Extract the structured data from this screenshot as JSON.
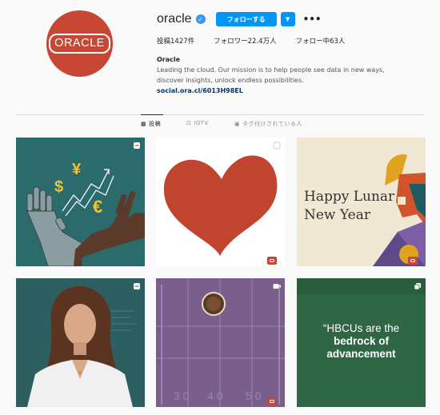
{
  "profile": {
    "avatar_text": "ORACLE",
    "username": "oracle",
    "follow_label": "フォローする",
    "dropdown_icon": "chevron-down-icon",
    "more_icon": "more-icon",
    "stats": {
      "posts": "投稿1427件",
      "followers": "フォロワー22.4万人",
      "following": "フォロー中63人"
    },
    "bio": {
      "name": "Oracle",
      "text": "Leading the cloud. Our mission is to help people see data in new ways, discover insights, unlock endless possibilities.",
      "link": "social.ora.cl/6013H98EL"
    }
  },
  "tabs": [
    {
      "label": "投稿",
      "icon": "grid-icon"
    },
    {
      "label": "IGTV",
      "icon": "igtv-icon"
    },
    {
      "label": "タグ付けされている人",
      "icon": "tag-icon"
    }
  ],
  "posts": {
    "lunar_text_1": "Happy Lunar",
    "lunar_text_2": "New Year",
    "hbcu_line1": "“HBCUs are the",
    "hbcu_line2": "bedrock of",
    "hbcu_line3": "advancement",
    "currency_dollar": "$",
    "currency_yen": "¥",
    "currency_euro": "€",
    "yard_30": "3 0",
    "yard_40": "4 0",
    "yard_50": "5 0"
  },
  "colors": {
    "brand_red": "#c74634",
    "follow_blue": "#0095f6"
  }
}
